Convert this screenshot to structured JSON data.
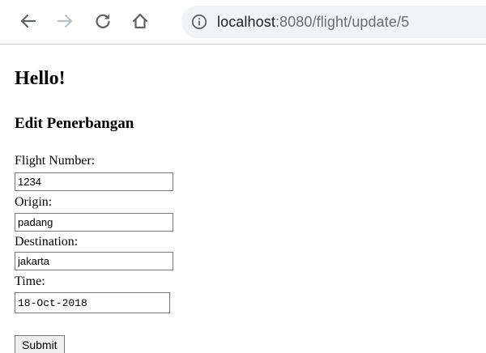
{
  "browser": {
    "url_host": "localhost",
    "url_rest": ":8080/flight/update/5",
    "icons": {
      "back": "back-arrow-icon",
      "forward": "forward-arrow-icon",
      "reload": "reload-icon",
      "home": "home-icon",
      "info": "info-icon"
    },
    "colors": {
      "omnibox_bg": "#f1f3f4",
      "icon_active": "#5f6368",
      "icon_disabled": "#bdc1c6"
    }
  },
  "page": {
    "heading": "Hello!",
    "form_title": "Edit Penerbangan"
  },
  "form": {
    "flight_number_label": "Flight Number:",
    "flight_number_value": "1234",
    "origin_label": "Origin:",
    "origin_value": "padang",
    "destination_label": "Destination:",
    "destination_value": "jakarta",
    "time_label": "Time:",
    "time_value": "18-Oct-2018",
    "submit_label": "Submit"
  }
}
